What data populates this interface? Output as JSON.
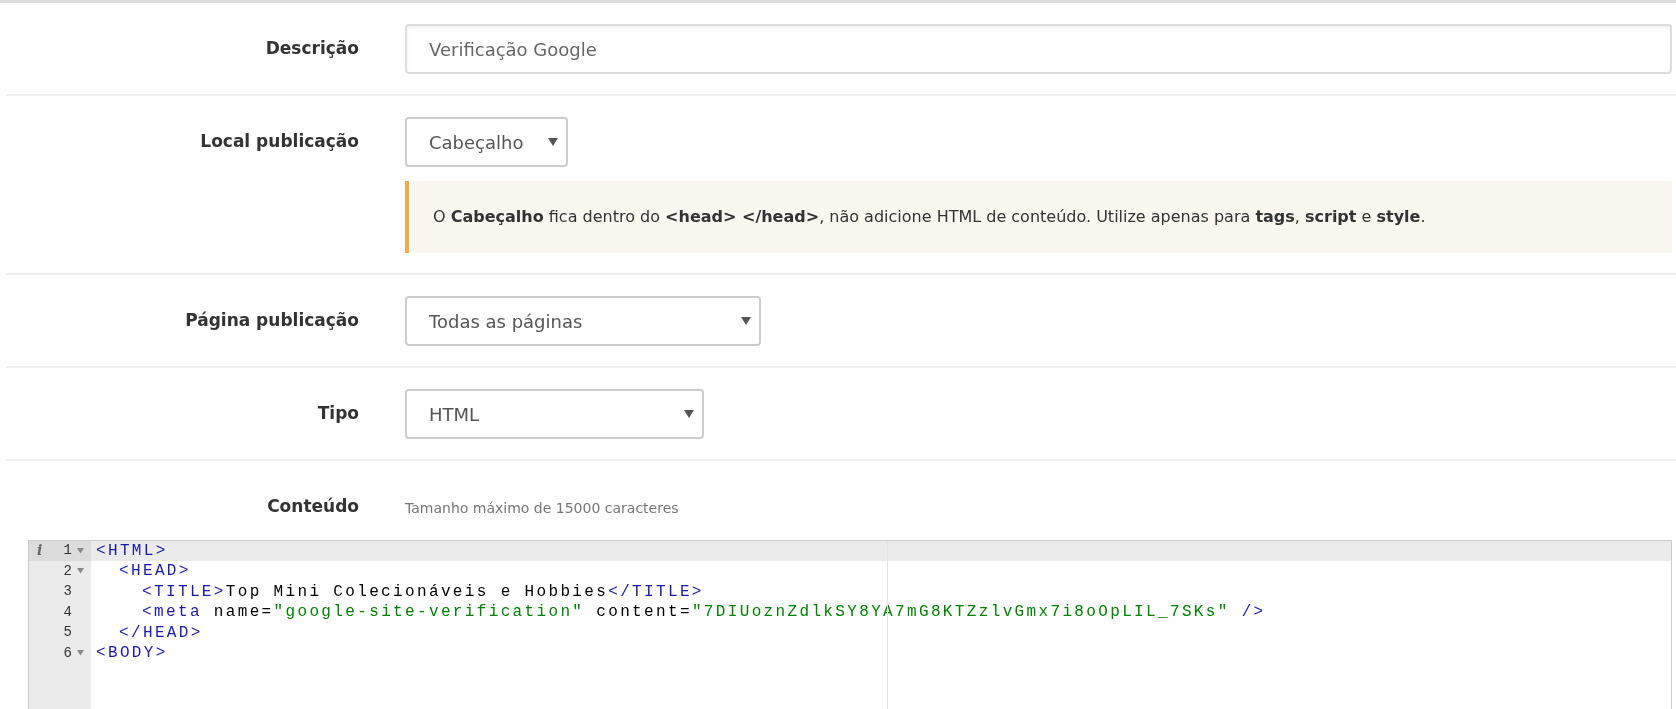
{
  "form": {
    "rows": [
      {
        "label": "Descrição",
        "kind": "input",
        "value": "Verificação Google"
      },
      {
        "label": "Local publicação",
        "kind": "select",
        "value": "Cabeçalho",
        "note": "O **Cabeçalho** fica dentro do **<head> </head>**, não adicione HTML de conteúdo. Utilize apenas para **tags**, **script** e **style**."
      },
      {
        "label": "Página publicação",
        "kind": "select",
        "value": "Todas as páginas"
      },
      {
        "label": "Tipo",
        "kind": "select",
        "value": "HTML"
      },
      {
        "label": "Conteúdo",
        "kind": "hint",
        "value": "Tamanho máximo de 15000 caracteres"
      }
    ]
  },
  "editor": {
    "lines": [
      {
        "number": "1",
        "gutter_mark": "i",
        "foldable": true,
        "active": true,
        "tokens": [
          {
            "kind": "tag",
            "text": "<HTML>"
          }
        ],
        "children": [
          {
            "number": "2",
            "foldable": true,
            "active": false,
            "tokens": [
              {
                "kind": "tag",
                "text": "<HEAD>"
              }
            ],
            "children": [
              {
                "number": "3",
                "foldable": false,
                "active": false,
                "tokens": [
                  {
                    "kind": "tag",
                    "text": "<TITLE>"
                  },
                  {
                    "kind": "plain",
                    "text": "Top Mini Colecionáveis e Hobbies"
                  },
                  {
                    "kind": "tag",
                    "text": "</TITLE>"
                  }
                ]
              },
              {
                "number": "4",
                "foldable": false,
                "active": false,
                "tokens": [
                  {
                    "kind": "tag",
                    "text": "<meta"
                  },
                  {
                    "kind": "plain",
                    "text": " name="
                  },
                  {
                    "kind": "string",
                    "text": "\"google-site-verification\""
                  },
                  {
                    "kind": "plain",
                    "text": " content="
                  },
                  {
                    "kind": "string",
                    "text": "\"7DIUoznZdlkSY8YA7mG8KTZzlvGmx7i8oOpLIL_7SKs\""
                  },
                  {
                    "kind": "tag",
                    "text": " />"
                  }
                ]
              }
            ]
          },
          {
            "number": "5",
            "foldable": false,
            "active": false,
            "tokens": [
              {
                "kind": "tag",
                "text": "</HEAD>"
              }
            ]
          }
        ]
      },
      {
        "number": "6",
        "foldable": true,
        "active": false,
        "tokens": [
          {
            "kind": "tag",
            "text": "<BODY>"
          }
        ]
      }
    ]
  }
}
